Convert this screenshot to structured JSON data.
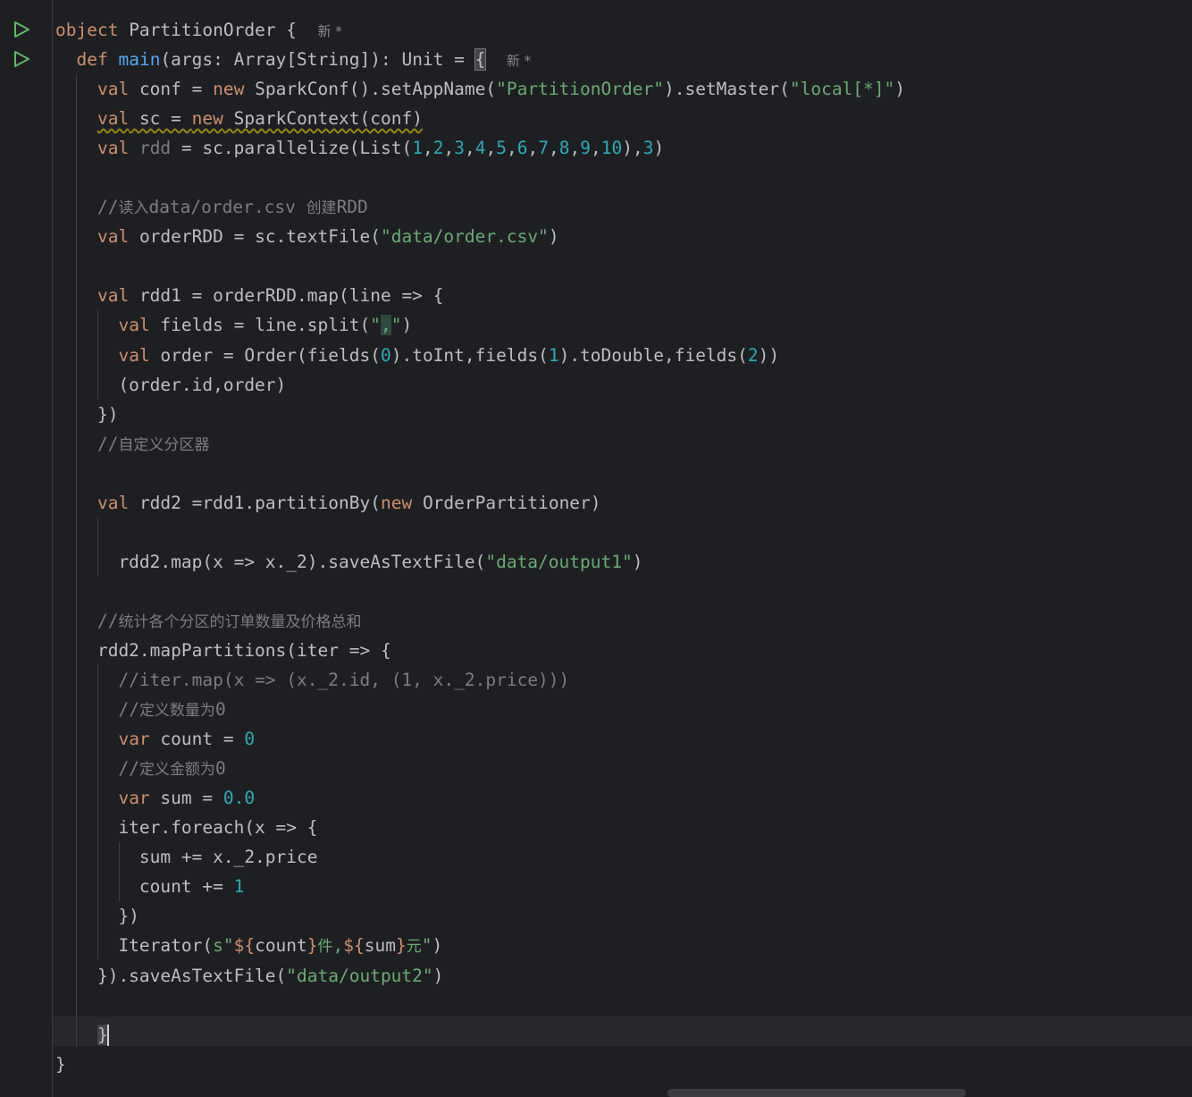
{
  "editor": {
    "hint_new": "新 *",
    "lines": [
      {
        "id": "l1",
        "indent": 0,
        "text": "object PartitionOrder {"
      },
      {
        "id": "l2",
        "indent": 1,
        "text": "def main(args: Array[String]): Unit = {"
      },
      {
        "id": "l3",
        "indent": 2,
        "text": "val conf = new SparkConf().setAppName(\"PartitionOrder\").setMaster(\"local[*]\")"
      },
      {
        "id": "l4",
        "indent": 2,
        "text": "val sc = new SparkContext(conf)"
      },
      {
        "id": "l5",
        "indent": 2,
        "text": "val rdd = sc.parallelize(List(1,2,3,4,5,6,7,8,9,10),3)"
      },
      {
        "id": "l6",
        "indent": 0,
        "text": ""
      },
      {
        "id": "l7",
        "indent": 2,
        "text": "//读入data/order.csv 创建RDD"
      },
      {
        "id": "l8",
        "indent": 2,
        "text": "val orderRDD = sc.textFile(\"data/order.csv\")"
      },
      {
        "id": "l9",
        "indent": 0,
        "text": ""
      },
      {
        "id": "l10",
        "indent": 2,
        "text": "val rdd1 = orderRDD.map(line => {"
      },
      {
        "id": "l11",
        "indent": 3,
        "text": "val fields = line.split(\",\")"
      },
      {
        "id": "l12",
        "indent": 3,
        "text": "val order = Order(fields(0).toInt,fields(1).toDouble,fields(2))"
      },
      {
        "id": "l13",
        "indent": 3,
        "text": "(order.id,order)"
      },
      {
        "id": "l14",
        "indent": 2,
        "text": "})"
      },
      {
        "id": "l15",
        "indent": 2,
        "text": "//自定义分区器"
      },
      {
        "id": "l16",
        "indent": 0,
        "text": ""
      },
      {
        "id": "l17",
        "indent": 2,
        "text": "val rdd2 =rdd1.partitionBy(new OrderPartitioner)"
      },
      {
        "id": "l18",
        "indent": 0,
        "text": ""
      },
      {
        "id": "l19",
        "indent": 3,
        "text": "rdd2.map(x => x._2).saveAsTextFile(\"data/output1\")"
      },
      {
        "id": "l20",
        "indent": 0,
        "text": ""
      },
      {
        "id": "l21",
        "indent": 2,
        "text": "//统计各个分区的订单数量及价格总和"
      },
      {
        "id": "l22",
        "indent": 2,
        "text": "rdd2.mapPartitions(iter => {"
      },
      {
        "id": "l23",
        "indent": 3,
        "text": "//iter.map(x => (x._2.id, (1, x._2.price)))"
      },
      {
        "id": "l24",
        "indent": 3,
        "text": "//定义数量为0"
      },
      {
        "id": "l25",
        "indent": 3,
        "text": "var count = 0"
      },
      {
        "id": "l26",
        "indent": 3,
        "text": "//定义金额为0"
      },
      {
        "id": "l27",
        "indent": 3,
        "text": "var sum = 0.0"
      },
      {
        "id": "l28",
        "indent": 3,
        "text": "iter.foreach(x => {"
      },
      {
        "id": "l29",
        "indent": 4,
        "text": "sum += x._2.price"
      },
      {
        "id": "l30",
        "indent": 4,
        "text": "count += 1"
      },
      {
        "id": "l31",
        "indent": 3,
        "text": "})"
      },
      {
        "id": "l32",
        "indent": 3,
        "text": "Iterator(s\"${count}件,${sum}元\")"
      },
      {
        "id": "l33",
        "indent": 2,
        "text": "}).saveAsTextFile(\"data/output2\")"
      },
      {
        "id": "l34",
        "indent": 0,
        "text": ""
      },
      {
        "id": "l35",
        "indent": 2,
        "text": "}"
      },
      {
        "id": "l36",
        "indent": 0,
        "text": "}"
      }
    ]
  },
  "colors": {
    "background": "#1e1f22",
    "keyword": "#cf8e6d",
    "function": "#56a8f5",
    "string": "#6aab73",
    "number": "#2aacb8",
    "comment": "#7a7e85",
    "text": "#bcbec4",
    "run_icon": "#5fb865"
  },
  "icons": {
    "run_object": "run-triangle-icon",
    "run_main": "run-triangle-icon"
  }
}
